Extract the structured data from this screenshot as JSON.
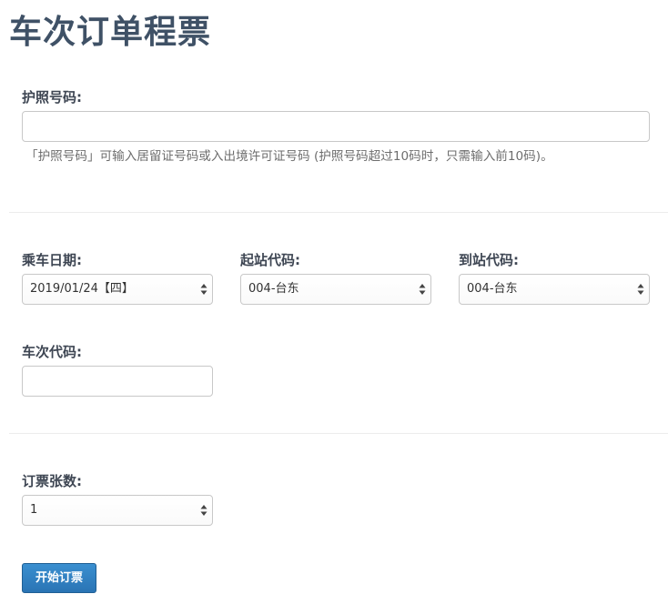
{
  "page": {
    "title": "车次订单程票"
  },
  "passport": {
    "label": "护照号码:",
    "value": "",
    "help": "「护照号码」可输入居留证号码或入出境许可证号码 (护照号码超过10码时，只需输入前10码)。"
  },
  "travel": {
    "date_label": "乘车日期:",
    "date_value": "2019/01/24【四】",
    "from_label": "起站代码:",
    "from_value": "004-台东",
    "to_label": "到站代码:",
    "to_value": "004-台东",
    "train_label": "车次代码:",
    "train_value": ""
  },
  "tickets": {
    "label": "订票张数:",
    "value": "1"
  },
  "actions": {
    "submit_label": "开始订票"
  },
  "colors": {
    "title": "#3f5166",
    "label": "#3e4653",
    "help": "#6d6d6d",
    "button": "#2a74b4",
    "border": "#c8c8c8"
  }
}
